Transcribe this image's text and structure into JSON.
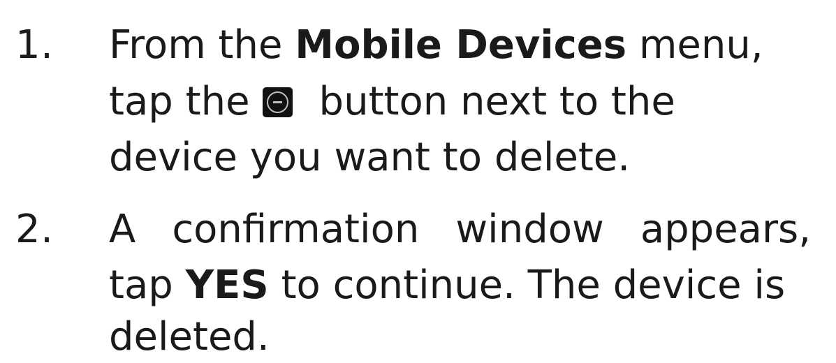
{
  "steps": [
    {
      "number": "1.",
      "line1_pre": "From the ",
      "line1_bold": "Mobile Devices",
      "line1_post": " menu,",
      "line2_pre": "tap the",
      "line2_post": "button next to the",
      "line3": "device you want to delete.",
      "icon": "minus-circle-icon"
    },
    {
      "number": "2.",
      "line1": "A confirmation window appears,",
      "line2_pre": "tap ",
      "line2_bold": "YES",
      "line2_post": " to continue. The device is",
      "line3": "deleted."
    }
  ],
  "colors": {
    "text": "#1a1a1a",
    "icon_background": "#111111",
    "icon_glyph": "#bdbdbd"
  }
}
